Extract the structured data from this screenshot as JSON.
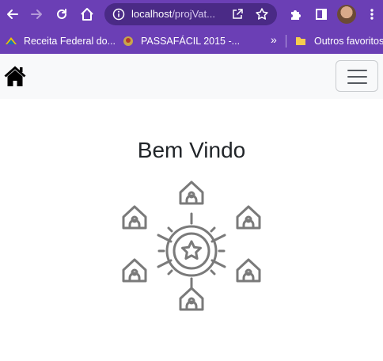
{
  "browser": {
    "url_host": "localhost",
    "url_path": "/projVat...",
    "bookmarks": [
      {
        "label": "Receita Federal do..."
      },
      {
        "label": "PASSAFÁCIL 2015 -..."
      }
    ],
    "more_bookmarks": "»",
    "other_bookmarks": "Outros favoritos"
  },
  "page": {
    "welcome_title": "Bem Vindo"
  },
  "colors": {
    "chrome_bg": "#6b3fb5",
    "omnibox_bg": "#4a2a86",
    "navbar_bg": "#f8f9fa",
    "illustration": "#7a7a7a"
  }
}
